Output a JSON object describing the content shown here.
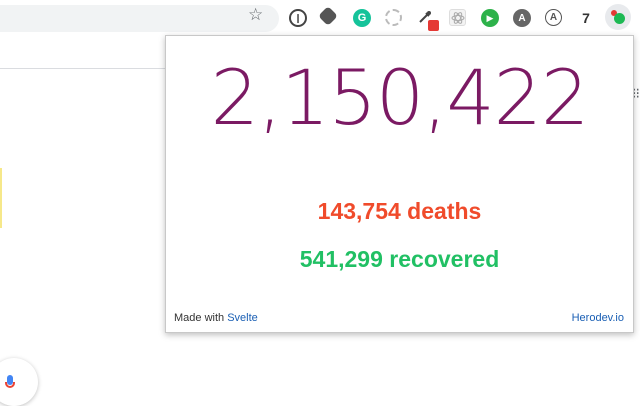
{
  "toolbar": {
    "extensions": [
      {
        "icon": "onepassword-icon"
      },
      {
        "icon": "gear-extension-icon"
      },
      {
        "icon": "grammarly-icon",
        "glyph": "G"
      },
      {
        "icon": "dashed-circle-icon"
      },
      {
        "icon": "eyedropper-icon"
      },
      {
        "icon": "react-devtools-icon"
      },
      {
        "icon": "play-icon",
        "glyph": "▶"
      },
      {
        "icon": "app-store-icon",
        "glyph": "A"
      },
      {
        "icon": "circle-a-icon",
        "glyph": "A"
      },
      {
        "icon": "seven-icon",
        "glyph": "7"
      },
      {
        "icon": "covid-tracker-icon"
      }
    ]
  },
  "popup": {
    "cases": "2,150,422",
    "deaths": "143,754 deaths",
    "recovered": "541,299 recovered",
    "footer": {
      "made_with": "Made with",
      "svelte_link": "Svelte",
      "herodev_link": "Herodev.io"
    }
  },
  "colors": {
    "cases": "#7b1a63",
    "deaths": "#f04b2b",
    "recovered": "#21c064",
    "link": "#1a5fb4"
  }
}
